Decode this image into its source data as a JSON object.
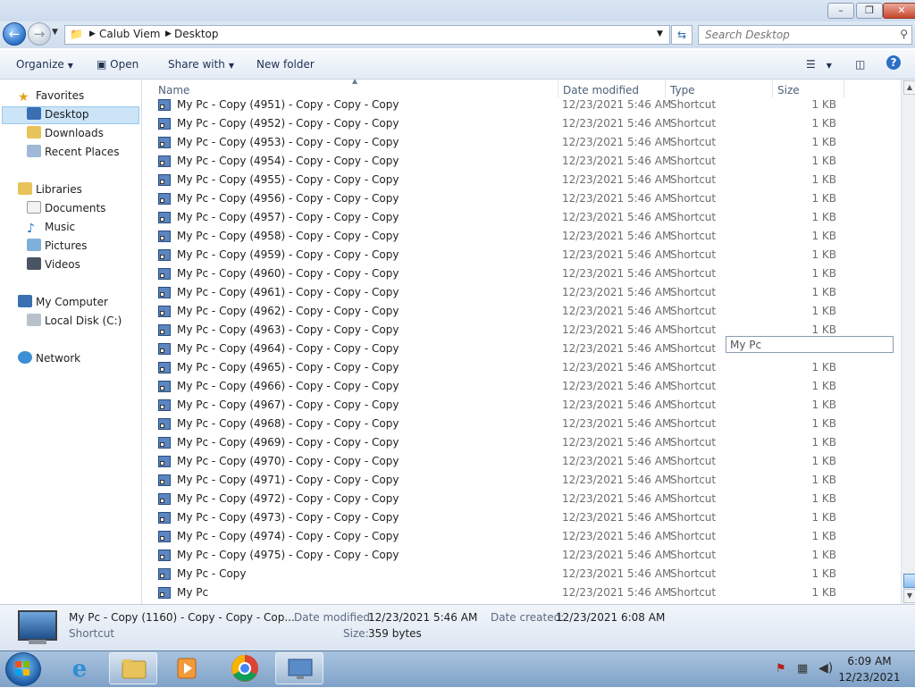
{
  "window": {
    "minimize_glyph": "–",
    "maximize_glyph": "❐",
    "close_glyph": "✕"
  },
  "nav_buttons": {
    "back_glyph": "←",
    "forward_glyph": "→",
    "history_glyph": "▼"
  },
  "address": {
    "segments": [
      "Calub Viem",
      "Desktop"
    ],
    "dropdown_glyph": "▼",
    "refresh_glyph": "⇆"
  },
  "search": {
    "placeholder": "Search Desktop"
  },
  "commandbar": {
    "organize": "Organize",
    "open": "Open",
    "share_with": "Share with",
    "new_folder": "New folder",
    "views_glyph": "☰",
    "help_glyph": "?"
  },
  "navpane": {
    "favorites": "Favorites",
    "desktop": "Desktop",
    "downloads": "Downloads",
    "recent_places": "Recent Places",
    "libraries": "Libraries",
    "documents": "Documents",
    "music": "Music",
    "pictures": "Pictures",
    "videos": "Videos",
    "my_computer": "My Computer",
    "local_disk": "Local Disk (C:)",
    "network": "Network"
  },
  "columns": {
    "name": "Name",
    "date_modified": "Date modified",
    "type": "Type",
    "size": "Size"
  },
  "files": [
    {
      "name": "My Pc - Copy (4951) - Copy - Copy - Copy",
      "date": "12/23/2021 5:46 AM",
      "type": "Shortcut",
      "size": "1 KB"
    },
    {
      "name": "My Pc - Copy (4952) - Copy - Copy - Copy",
      "date": "12/23/2021 5:46 AM",
      "type": "Shortcut",
      "size": "1 KB"
    },
    {
      "name": "My Pc - Copy (4953) - Copy - Copy - Copy",
      "date": "12/23/2021 5:46 AM",
      "type": "Shortcut",
      "size": "1 KB"
    },
    {
      "name": "My Pc - Copy (4954) - Copy - Copy - Copy",
      "date": "12/23/2021 5:46 AM",
      "type": "Shortcut",
      "size": "1 KB"
    },
    {
      "name": "My Pc - Copy (4955) - Copy - Copy - Copy",
      "date": "12/23/2021 5:46 AM",
      "type": "Shortcut",
      "size": "1 KB"
    },
    {
      "name": "My Pc - Copy (4956) - Copy - Copy - Copy",
      "date": "12/23/2021 5:46 AM",
      "type": "Shortcut",
      "size": "1 KB"
    },
    {
      "name": "My Pc - Copy (4957) - Copy - Copy - Copy",
      "date": "12/23/2021 5:46 AM",
      "type": "Shortcut",
      "size": "1 KB"
    },
    {
      "name": "My Pc - Copy (4958) - Copy - Copy - Copy",
      "date": "12/23/2021 5:46 AM",
      "type": "Shortcut",
      "size": "1 KB"
    },
    {
      "name": "My Pc - Copy (4959) - Copy - Copy - Copy",
      "date": "12/23/2021 5:46 AM",
      "type": "Shortcut",
      "size": "1 KB"
    },
    {
      "name": "My Pc - Copy (4960) - Copy - Copy - Copy",
      "date": "12/23/2021 5:46 AM",
      "type": "Shortcut",
      "size": "1 KB"
    },
    {
      "name": "My Pc - Copy (4961) - Copy - Copy - Copy",
      "date": "12/23/2021 5:46 AM",
      "type": "Shortcut",
      "size": "1 KB"
    },
    {
      "name": "My Pc - Copy (4962) - Copy - Copy - Copy",
      "date": "12/23/2021 5:46 AM",
      "type": "Shortcut",
      "size": "1 KB"
    },
    {
      "name": "My Pc - Copy (4963) - Copy - Copy - Copy",
      "date": "12/23/2021 5:46 AM",
      "type": "Shortcut",
      "size": "1 KB"
    },
    {
      "name": "My Pc - Copy (4964) - Copy - Copy - Copy",
      "date": "12/23/2021 5:46 AM",
      "type": "Shortcut",
      "size": ""
    },
    {
      "name": "My Pc - Copy (4965) - Copy - Copy - Copy",
      "date": "12/23/2021 5:46 AM",
      "type": "Shortcut",
      "size": "1 KB"
    },
    {
      "name": "My Pc - Copy (4966) - Copy - Copy - Copy",
      "date": "12/23/2021 5:46 AM",
      "type": "Shortcut",
      "size": "1 KB"
    },
    {
      "name": "My Pc - Copy (4967) - Copy - Copy - Copy",
      "date": "12/23/2021 5:46 AM",
      "type": "Shortcut",
      "size": "1 KB"
    },
    {
      "name": "My Pc - Copy (4968) - Copy - Copy - Copy",
      "date": "12/23/2021 5:46 AM",
      "type": "Shortcut",
      "size": "1 KB"
    },
    {
      "name": "My Pc - Copy (4969) - Copy - Copy - Copy",
      "date": "12/23/2021 5:46 AM",
      "type": "Shortcut",
      "size": "1 KB"
    },
    {
      "name": "My Pc - Copy (4970) - Copy - Copy - Copy",
      "date": "12/23/2021 5:46 AM",
      "type": "Shortcut",
      "size": "1 KB"
    },
    {
      "name": "My Pc - Copy (4971) - Copy - Copy - Copy",
      "date": "12/23/2021 5:46 AM",
      "type": "Shortcut",
      "size": "1 KB"
    },
    {
      "name": "My Pc - Copy (4972) - Copy - Copy - Copy",
      "date": "12/23/2021 5:46 AM",
      "type": "Shortcut",
      "size": "1 KB"
    },
    {
      "name": "My Pc - Copy (4973) - Copy - Copy - Copy",
      "date": "12/23/2021 5:46 AM",
      "type": "Shortcut",
      "size": "1 KB"
    },
    {
      "name": "My Pc - Copy (4974) - Copy - Copy - Copy",
      "date": "12/23/2021 5:46 AM",
      "type": "Shortcut",
      "size": "1 KB"
    },
    {
      "name": "My Pc - Copy (4975) - Copy - Copy - Copy",
      "date": "12/23/2021 5:46 AM",
      "type": "Shortcut",
      "size": "1 KB"
    },
    {
      "name": "My Pc - Copy",
      "date": "12/23/2021 5:46 AM",
      "type": "Shortcut",
      "size": "1 KB"
    },
    {
      "name": "My Pc",
      "date": "12/23/2021 5:46 AM",
      "type": "Shortcut",
      "size": "1 KB"
    }
  ],
  "rename_box": {
    "value": "My Pc"
  },
  "scroll": {
    "up_glyph": "▲",
    "down_glyph": "▼",
    "position_fraction": 1.0
  },
  "details": {
    "name": "My Pc - Copy (1160) - Copy - Copy - Cop...",
    "type": "Shortcut",
    "date_modified_label": "Date modified:",
    "date_modified": "12/23/2021 5:46 AM",
    "size_label": "Size:",
    "size": "359 bytes",
    "date_created_label": "Date created:",
    "date_created": "12/23/2021 6:08 AM"
  },
  "taskbar": {
    "time": "6:09 AM",
    "date": "12/23/2021",
    "apps": [
      "internet-explorer",
      "windows-explorer",
      "media-player",
      "chrome",
      "remote-desktop"
    ]
  },
  "colors": {
    "selection": "#cce4f7",
    "accent": "#2b6fc6",
    "close": "#c8452a"
  }
}
